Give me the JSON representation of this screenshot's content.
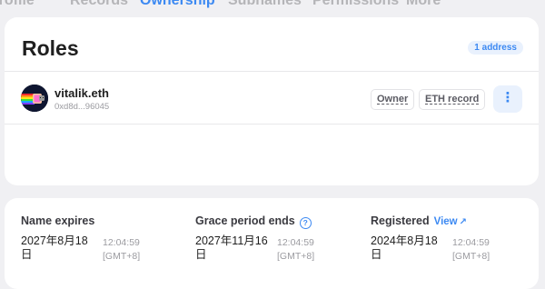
{
  "tabs": [
    {
      "label": "Profile"
    },
    {
      "label": "Records"
    },
    {
      "label": "Ownership"
    },
    {
      "label": "Subnames"
    },
    {
      "label": "Permissions"
    },
    {
      "label": "More"
    }
  ],
  "active_tab": "Ownership",
  "roles": {
    "title": "Roles",
    "address_count": "1 address",
    "owner": {
      "name": "vitalik.eth",
      "address": "0xd8d...96045",
      "tags": [
        "Owner",
        "ETH record"
      ]
    },
    "more_icon": "vertical-ellipsis-icon"
  },
  "dates": {
    "expires": {
      "label": "Name expires",
      "date": "2027年8月18日",
      "time": "12:04:59 [GMT+8]"
    },
    "grace": {
      "label": "Grace period ends",
      "date": "2027年11月16日",
      "time": "12:04:59 [GMT+8]",
      "icon": "question-icon"
    },
    "registered": {
      "label": "Registered",
      "link": "View",
      "link_icon": "external-link-icon",
      "date": "2024年8月18日",
      "time": "12:04:59 [GMT+8]"
    }
  },
  "colors": {
    "accent": "#3c89f2",
    "background": "#f0f0f3",
    "card": "#ffffff",
    "muted_text": "#9b9ba0"
  }
}
